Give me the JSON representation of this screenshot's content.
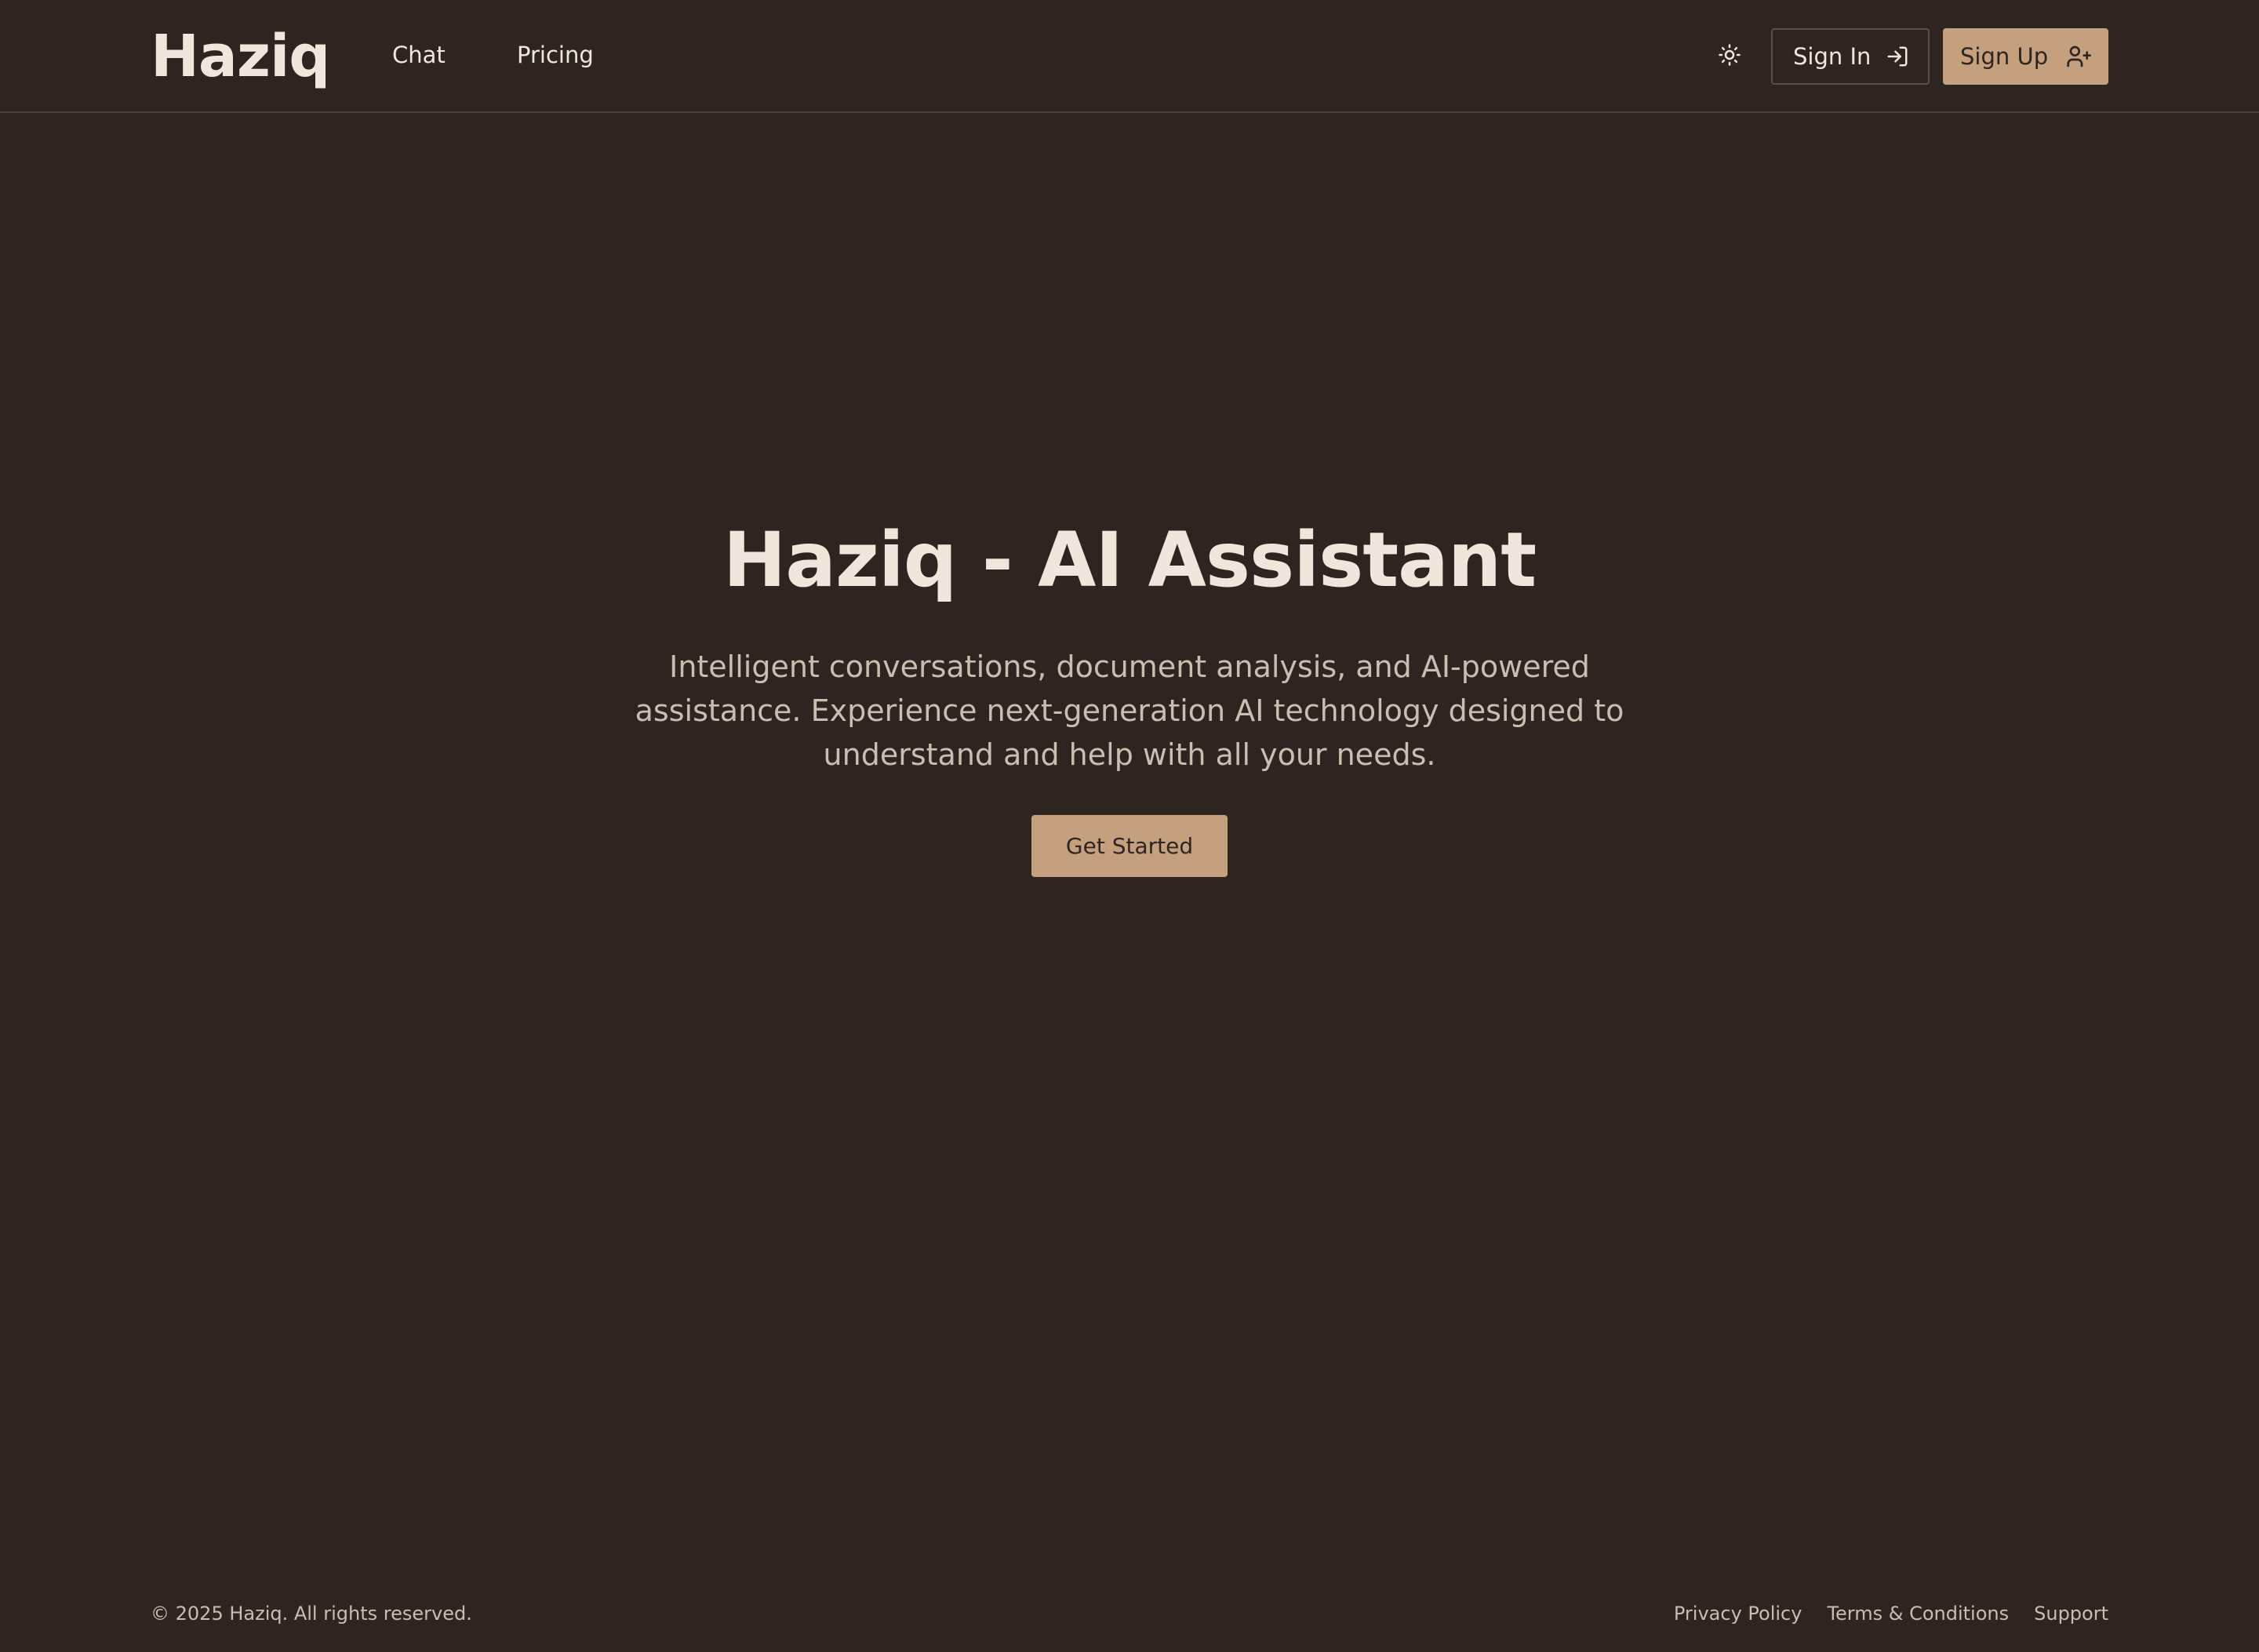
{
  "header": {
    "logo": "Haziq",
    "nav": [
      {
        "label": "Chat"
      },
      {
        "label": "Pricing"
      }
    ],
    "theme_toggle_icon": "sun-icon",
    "sign_in": {
      "label": "Sign In",
      "icon": "log-in-icon"
    },
    "sign_up": {
      "label": "Sign Up",
      "icon": "user-plus-icon"
    }
  },
  "hero": {
    "title": "Haziq - AI Assistant",
    "subtitle": "Intelligent conversations, document analysis, and AI-powered assistance. Experience next-generation AI technology designed to understand and help with all your needs.",
    "cta_label": "Get Started"
  },
  "footer": {
    "copyright": "© 2025 Haziq. All rights reserved.",
    "links": [
      {
        "label": "Privacy Policy"
      },
      {
        "label": "Terms & Conditions"
      },
      {
        "label": "Support"
      }
    ]
  },
  "colors": {
    "background": "#2e2521",
    "foreground": "#efe6dc",
    "muted_text": "#cbbdb0",
    "accent": "#c4a07f",
    "border": "#4a403b"
  }
}
